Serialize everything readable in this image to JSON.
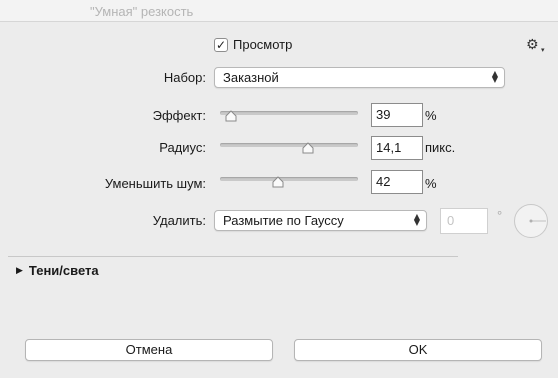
{
  "window": {
    "title": "\"Умная\" резкость"
  },
  "preview": {
    "label": "Просмотр",
    "checked": true,
    "check_glyph": "✓"
  },
  "gear": {
    "icon": "gear-icon",
    "glyph": "⚙",
    "caret": "▾"
  },
  "preset": {
    "label": "Набор:",
    "value": "Заказной"
  },
  "sliders": [
    {
      "label": "Эффект:",
      "value": "39",
      "unit": "%",
      "level": 0.08
    },
    {
      "label": "Радиус:",
      "value": "14,1",
      "unit": "пикс.",
      "level": 0.64
    },
    {
      "label": "Уменьшить шум:",
      "value": "42",
      "unit": "%",
      "level": 0.42
    }
  ],
  "remove": {
    "label": "Удалить:",
    "value": "Размытие по Гауссу",
    "angle_value": "0",
    "angle_unit": "°"
  },
  "shadows_section": {
    "label": "Тени/света",
    "expand_icon": "▶"
  },
  "buttons": {
    "cancel": "Отмена",
    "ok": "OK"
  },
  "colors": {
    "window_bg": "#ececec",
    "track": "#c9c9c9",
    "field_border": "#8c8c8c"
  }
}
